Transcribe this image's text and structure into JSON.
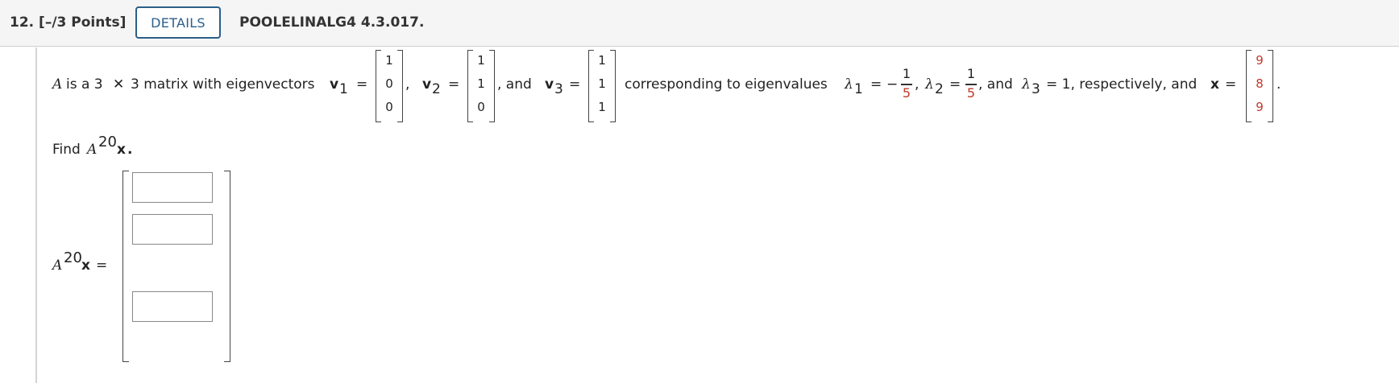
{
  "header": {
    "question_number": "12.",
    "points": "[–/3 Points]",
    "details_label": "DETAILS",
    "source": "POOLELINALG4 4.3.017."
  },
  "problem": {
    "A": "A",
    "t1": "is a 3",
    "times": "✕",
    "t2": "3 matrix with eigenvectors",
    "v": "v",
    "sub1": "1",
    "sub2": "2",
    "sub3": "3",
    "eq": "=",
    "comma": ",",
    "and_v3": ", and",
    "corresponding": "corresponding to eigenvalues",
    "lambda": "λ",
    "minus": "−",
    "comma_lambda": ",",
    "and_lambda3": ", and",
    "respectively": "= 1, respectively, and",
    "x": "x",
    "period": ".",
    "v1": [
      "1",
      "0",
      "0"
    ],
    "v2": [
      "1",
      "1",
      "0"
    ],
    "v3": [
      "1",
      "1",
      "1"
    ],
    "x_vec": [
      "9",
      "8",
      "9"
    ],
    "frac1": {
      "num": "1",
      "den": "5"
    },
    "frac2": {
      "num": "1",
      "den": "5"
    }
  },
  "find": {
    "label": "Find",
    "A": "A",
    "exp": "20",
    "x": "x",
    "period": "."
  },
  "answer": {
    "A": "A",
    "exp": "20",
    "x": "x",
    "eq": "=",
    "values": [
      "",
      "",
      ""
    ]
  }
}
